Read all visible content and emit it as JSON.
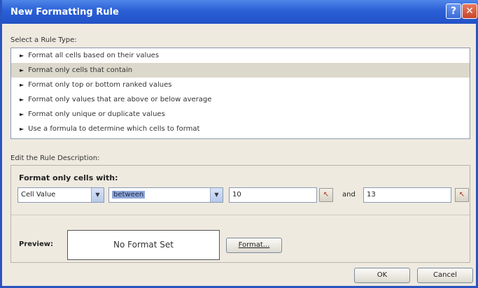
{
  "window": {
    "title": "New Formatting Rule"
  },
  "rule_type": {
    "label": "Select a Rule Type:",
    "items": [
      "Format all cells based on their values",
      "Format only cells that contain",
      "Format only top or bottom ranked values",
      "Format only values that are above or below average",
      "Format only unique or duplicate values",
      "Use a formula to determine which cells to format"
    ],
    "selected_index": 1
  },
  "description": {
    "label": "Edit the Rule Description:",
    "format_only_label": "Format only cells with:",
    "condition_type": "Cell Value",
    "operator": "between",
    "value1": "10",
    "and_label": "and",
    "value2": "13",
    "preview_label": "Preview:",
    "preview_text": "No Format Set",
    "format_button": "Format..."
  },
  "buttons": {
    "ok": "OK",
    "cancel": "Cancel"
  }
}
